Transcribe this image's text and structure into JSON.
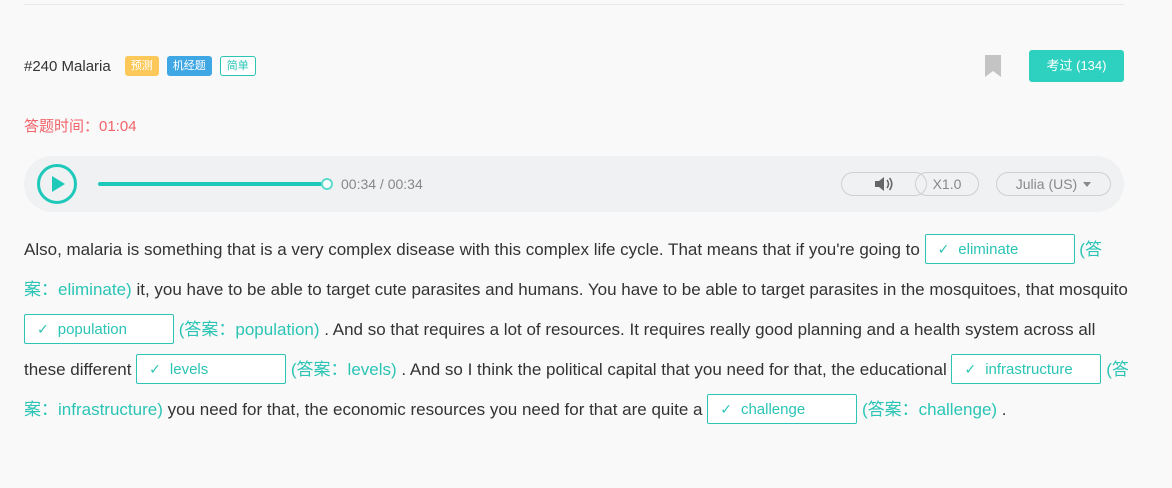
{
  "header": {
    "title": "#240 Malaria",
    "tags": [
      "预测",
      "机经题",
      "简单"
    ],
    "done_button": "考过 (134)"
  },
  "timer": "答题时间：01:04",
  "player": {
    "time": "00:34 / 00:34",
    "progress": 1.0,
    "speed": "X1.0",
    "voice": "Julia (US)"
  },
  "passage": {
    "seg0": "Also, malaria is something that is a very complex disease with this complex life cycle. That means that if you're going to ",
    "seg1": " it, you have to be able to target cute parasites and humans. You have to be able to target parasites in the mosquitoes, that mosquito ",
    "seg2": " . And so that requires a lot of resources. It requires really good planning and a health system across all these different ",
    "seg3": " . And so I think the political capital that you need for that, the educational ",
    "seg4": " you need for that, the economic resources you need for that are quite a ",
    "seg5": " .",
    "check_mark": "✓",
    "blanks": [
      {
        "value": "eliminate",
        "answer": "(答案：eliminate)"
      },
      {
        "value": "population",
        "answer": "(答案：population)"
      },
      {
        "value": "levels",
        "answer": "(答案：levels)"
      },
      {
        "value": "infrastructure",
        "answer": "(答案：infrastructure)"
      },
      {
        "value": "challenge",
        "answer": "(答案：challenge)"
      }
    ]
  }
}
